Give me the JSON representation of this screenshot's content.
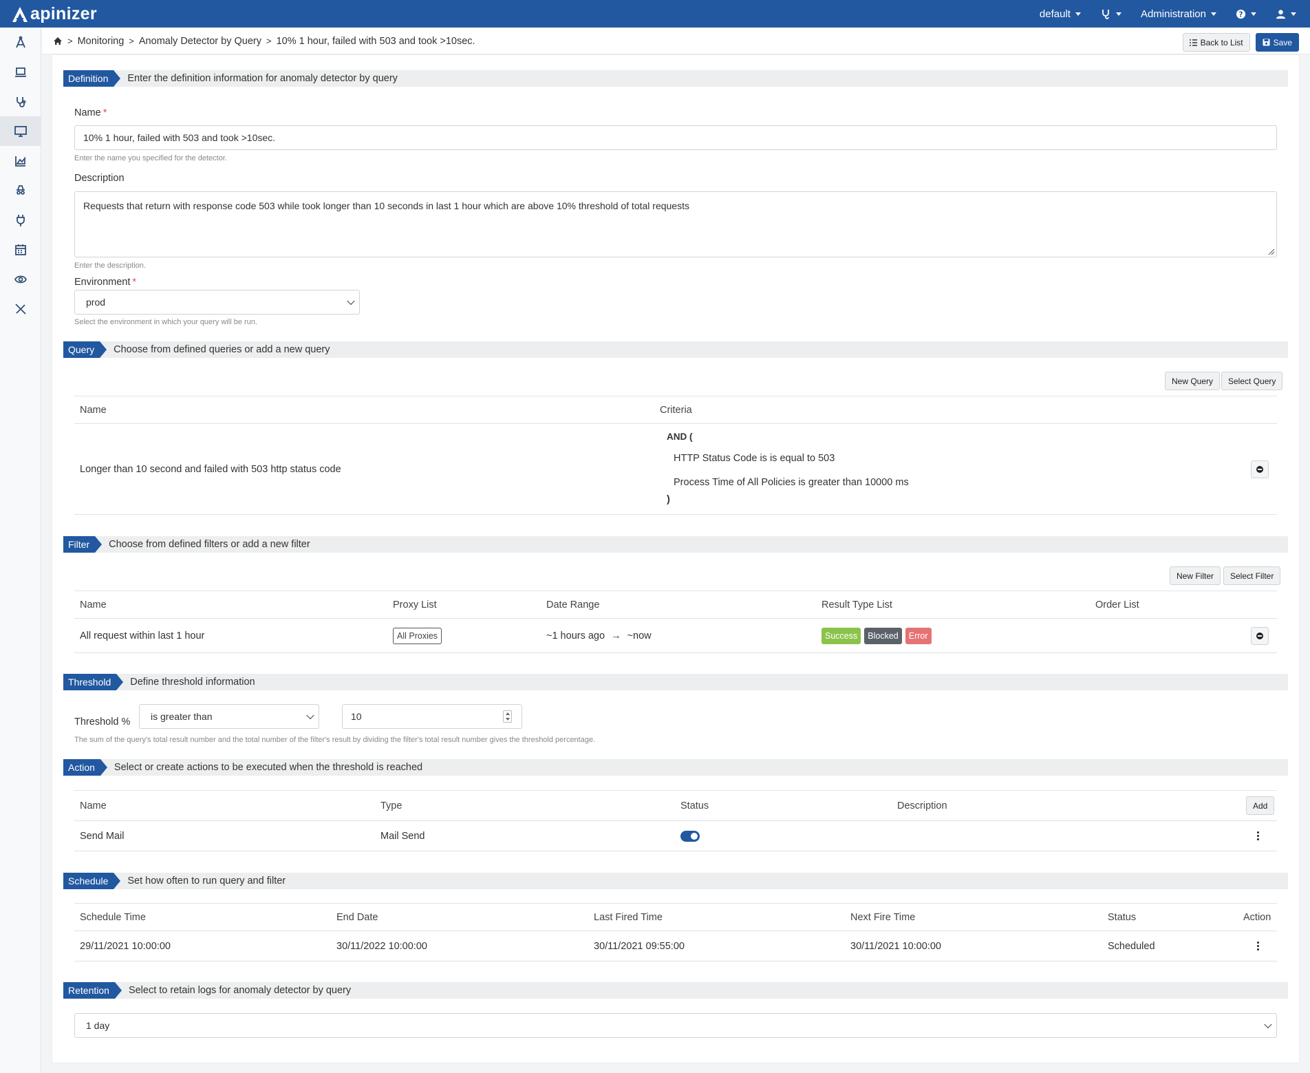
{
  "app": {
    "logo_text": "apinizer"
  },
  "topnav": {
    "project": "default",
    "admin": "Administration"
  },
  "breadcrumb": {
    "items": [
      "Monitoring",
      "Anomaly Detector by Query",
      "10% 1 hour, failed with 503 and took >10sec."
    ]
  },
  "actions": {
    "back": "Back to List",
    "save": "Save"
  },
  "definition": {
    "tag": "Definition",
    "text": "Enter the definition information for anomaly detector by query",
    "name_label": "Name",
    "name_value": "10% 1 hour, failed with 503 and took >10sec.",
    "name_help": "Enter the name you specified for the detector.",
    "desc_label": "Description",
    "desc_value": "Requests that return with response code 503 while took longer than 10 seconds in last 1 hour which are above 10% threshold of total requests",
    "desc_help": "Enter the description.",
    "env_label": "Environment",
    "env_value": "prod",
    "env_help": "Select the environment in which your query will be run."
  },
  "query": {
    "tag": "Query",
    "text": "Choose from defined queries or add a new query",
    "new_btn": "New Query",
    "select_btn": "Select Query",
    "headers": [
      "Name",
      "Criteria"
    ],
    "row": {
      "name": "Longer than 10 second and failed with 503 http status code",
      "and_open": "AND (",
      "criteria": [
        "HTTP Status Code is is equal to 503",
        "Process Time of All Policies is greater than 10000 ms"
      ],
      "close": ")"
    }
  },
  "filter": {
    "tag": "Filter",
    "text": "Choose from defined filters or add a new filter",
    "new_btn": "New Filter",
    "select_btn": "Select Filter",
    "headers": [
      "Name",
      "Proxy List",
      "Date Range",
      "Result Type List",
      "Order List"
    ],
    "row": {
      "name": "All request within last 1 hour",
      "proxy": "All Proxies",
      "date_from": "~1 hours ago",
      "arrow": "→",
      "date_to": "~now",
      "results": [
        {
          "label": "Success",
          "color": "#8bc34a"
        },
        {
          "label": "Blocked",
          "color": "#5b6069"
        },
        {
          "label": "Error",
          "color": "#e57373"
        }
      ]
    }
  },
  "threshold": {
    "tag": "Threshold",
    "text": "Define threshold information",
    "label": "Threshold %",
    "operator": "is greater than",
    "value": "10",
    "help": "The sum of the query's total result number and the total number of the filter's result by dividing the filter's total result number gives the threshold percentage."
  },
  "action": {
    "tag": "Action",
    "text": "Select or create actions to be executed when the threshold is reached",
    "headers": [
      "Name",
      "Type",
      "Status",
      "Description"
    ],
    "add_btn": "Add",
    "row": {
      "name": "Send Mail",
      "type": "Mail Send",
      "status_on": true
    }
  },
  "schedule": {
    "tag": "Schedule",
    "text": "Set how often to run query and filter",
    "headers": [
      "Schedule Time",
      "End Date",
      "Last Fired Time",
      "Next Fire Time",
      "Status",
      "Action"
    ],
    "row": {
      "schedule_time": "29/11/2021 10:00:00",
      "end_date": "30/11/2022 10:00:00",
      "last_fired": "30/11/2021 09:55:00",
      "next_fire": "30/11/2021 10:00:00",
      "status": "Scheduled"
    }
  },
  "retention": {
    "tag": "Retention",
    "text": "Select to retain logs for anomaly detector by query",
    "value": "1 day"
  },
  "colors": {
    "brand": "#2158a0"
  },
  "icons": {
    "sidebar": [
      "api-design-icon",
      "laptop-icon",
      "stethoscope-icon",
      "monitor-icon",
      "chart-icon",
      "spy-icon",
      "plug-icon",
      "calendar-icon",
      "eye-icon",
      "tools-icon"
    ]
  }
}
